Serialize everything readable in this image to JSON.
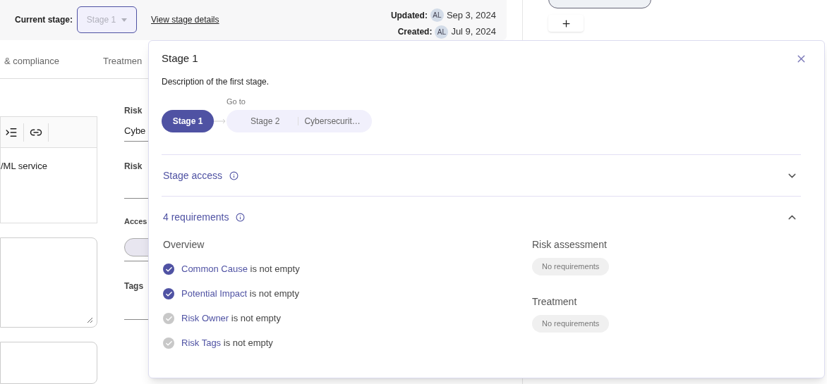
{
  "header": {
    "current_stage_label": "Current stage:",
    "stage_select": {
      "value": "Stage 1"
    },
    "details_link": "View stage details",
    "meta": [
      {
        "label": "Updated:",
        "avatar": "AL",
        "date": "Sep 3, 2024"
      },
      {
        "label": "Created:",
        "avatar": "AL",
        "date": "Jul 9, 2024"
      }
    ]
  },
  "tabs": [
    {
      "label": "& compliance",
      "selected": false
    },
    {
      "label": "Treatmen",
      "selected": false
    }
  ],
  "form": {
    "description_text": "/ML service",
    "fields": [
      {
        "label": "Risk",
        "value": "Cybe"
      },
      {
        "label": "Risk"
      },
      {
        "label": "Acces"
      },
      {
        "label": "Tags"
      }
    ]
  },
  "popover": {
    "title": "Stage 1",
    "description": "Description of the first stage.",
    "goto_label": "Go to",
    "stages": [
      {
        "label": "Stage 1",
        "selected": true
      },
      {
        "label": "Stage 2",
        "selected": false
      },
      {
        "label": "Cybersecurit…",
        "selected": false
      }
    ],
    "sections": [
      {
        "title": "Stage access",
        "expanded": false
      },
      {
        "title": "4 requirements",
        "expanded": true,
        "overview": {
          "title": "Overview",
          "requirements": [
            {
              "field": "Common Cause",
              "suffix": "is not empty",
              "met": true
            },
            {
              "field": "Potential Impact",
              "suffix": "is not empty",
              "met": true
            },
            {
              "field": "Risk Owner",
              "suffix": "is not empty",
              "met": false
            },
            {
              "field": "Risk Tags",
              "suffix": "is not empty",
              "met": false
            }
          ]
        },
        "groups": [
          {
            "title": "Risk assessment",
            "badge": "No requirements"
          },
          {
            "title": "Treatment",
            "badge": "No requirements"
          }
        ]
      }
    ]
  }
}
